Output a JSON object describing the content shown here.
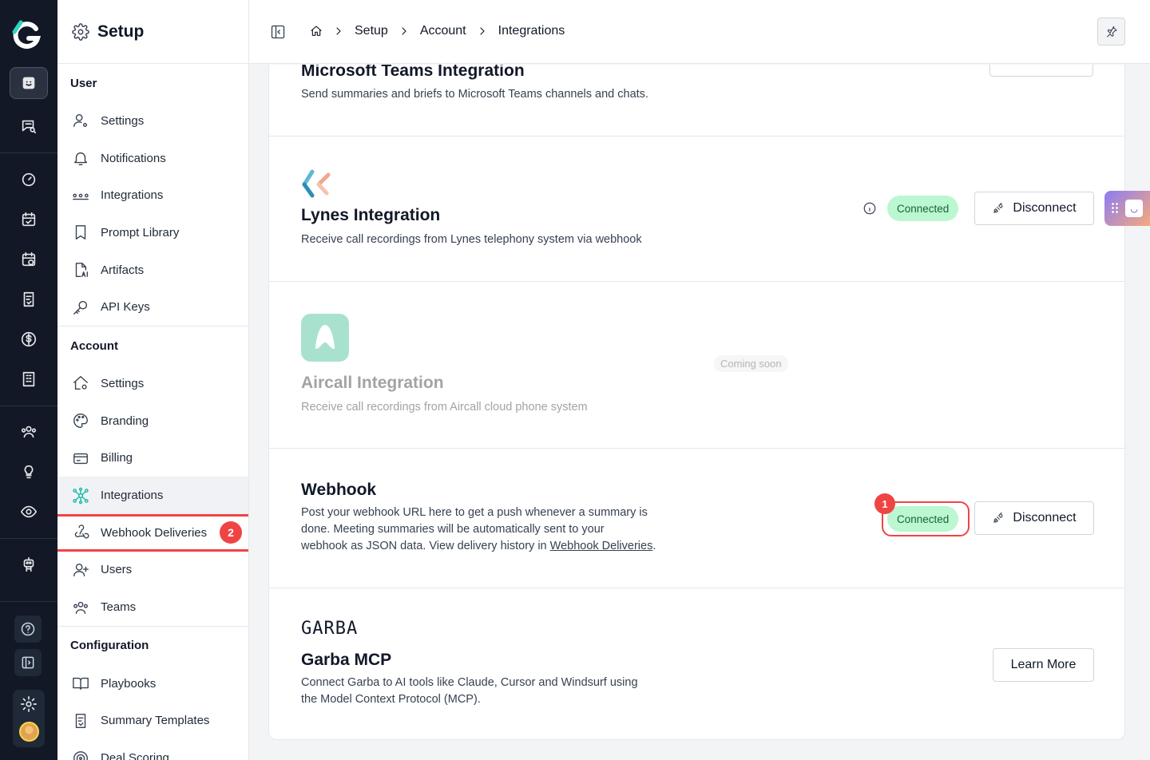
{
  "app": {
    "section_title": "Setup"
  },
  "breadcrumb": [
    "Setup",
    "Account",
    "Integrations"
  ],
  "sidebar": {
    "user_section": "User",
    "user_items": [
      "Settings",
      "Notifications",
      "Integrations",
      "Prompt Library",
      "Artifacts",
      "API Keys"
    ],
    "account_section": "Account",
    "account_items": [
      "Settings",
      "Branding",
      "Billing",
      "Integrations",
      "Webhook Deliveries",
      "Users",
      "Teams"
    ],
    "config_section": "Configuration",
    "config_items": [
      "Playbooks",
      "Summary Templates",
      "Deal Scoring"
    ],
    "active_item": "Integrations",
    "highlight_badge": "2"
  },
  "integrations": {
    "teams": {
      "title": "Microsoft Teams Integration",
      "description": "Send summaries and briefs to Microsoft Teams channels and chats."
    },
    "lynes": {
      "title": "Lynes Integration",
      "description": "Receive call recordings from Lynes telephony system via webhook",
      "status": "Connected",
      "action": "Disconnect"
    },
    "aircall": {
      "title": "Aircall Integration",
      "description": "Receive call recordings from Aircall cloud phone system",
      "status": "Coming soon"
    },
    "webhook": {
      "title": "Webhook",
      "description_line1": "Post your webhook URL here to get a push whenever a summary is",
      "description_line2": "done. Meeting summaries will be automatically sent to your",
      "description_line3_pre": "webhook as JSON data. View delivery history in ",
      "description_link": "Webhook Deliveries",
      "description_line3_post": ".",
      "status": "Connected",
      "action": "Disconnect",
      "highlight_badge": "1"
    },
    "garba": {
      "logo_text": "GARBA",
      "title": "Garba MCP",
      "description_line1": "Connect Garba to AI tools like Claude, Cursor and Windsurf using",
      "description_line2": "the Model Context Protocol (MCP).",
      "action": "Learn More"
    }
  },
  "colors": {
    "rail_bg": "#121826",
    "connected_bg": "#bbf7d0",
    "highlight": "#ef4444",
    "accent": "#14b8a6"
  }
}
